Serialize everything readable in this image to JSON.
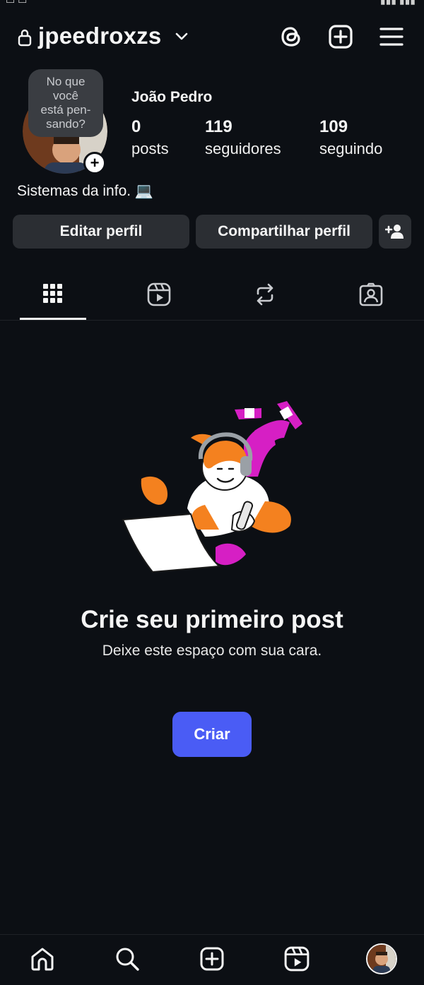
{
  "header": {
    "username": "jpeedroxzs",
    "icons": [
      "lock-icon",
      "chevron-down-icon",
      "threads-icon",
      "new-post-icon",
      "menu-icon"
    ]
  },
  "note": {
    "lines": [
      "No que",
      "você",
      "está pen-",
      "sando?"
    ]
  },
  "profile": {
    "display_name": "João Pedro",
    "bio": "Sistemas da info. 💻",
    "stats": {
      "posts": {
        "value": "0",
        "label": "posts"
      },
      "followers": {
        "value": "119",
        "label": "seguidores"
      },
      "following": {
        "value": "109",
        "label": "seguindo"
      }
    }
  },
  "actions": {
    "edit": "Editar perfil",
    "share": "Compartilhar perfil"
  },
  "tabs": [
    {
      "name": "grid",
      "icon": "grid-icon",
      "selected": true
    },
    {
      "name": "reels",
      "icon": "reels-icon",
      "selected": false
    },
    {
      "name": "reposts",
      "icon": "repost-icon",
      "selected": false
    },
    {
      "name": "tagged",
      "icon": "tagged-icon",
      "selected": false
    }
  ],
  "empty_state": {
    "title": "Crie seu primeiro post",
    "subtitle": "Deixe este espaço com sua cara.",
    "button": "Criar"
  },
  "bottom_nav": [
    "home-icon",
    "search-icon",
    "create-icon",
    "reels-icon",
    "profile-avatar"
  ],
  "colors": {
    "background": "#0c0f14",
    "button": "#2b2e33",
    "accent": "#4a5cf5",
    "illustration_orange": "#f4811f",
    "illustration_magenta": "#d61fc4"
  }
}
